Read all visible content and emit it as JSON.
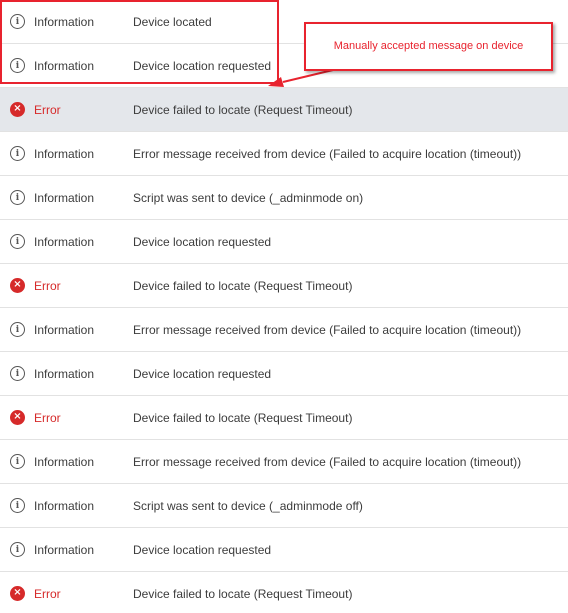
{
  "log_entries": [
    {
      "level": "info",
      "level_label": "Information",
      "message": "Device located"
    },
    {
      "level": "info",
      "level_label": "Information",
      "message": "Device location requested"
    },
    {
      "level": "error",
      "level_label": "Error",
      "message": "Device failed to locate (Request Timeout)"
    },
    {
      "level": "info",
      "level_label": "Information",
      "message": "Error message received from device (Failed to acquire location (timeout))"
    },
    {
      "level": "info",
      "level_label": "Information",
      "message": "Script was sent to device (_adminmode on)"
    },
    {
      "level": "info",
      "level_label": "Information",
      "message": "Device location requested"
    },
    {
      "level": "error",
      "level_label": "Error",
      "message": "Device failed to locate (Request Timeout)"
    },
    {
      "level": "info",
      "level_label": "Information",
      "message": "Error message received from device (Failed to acquire location (timeout))"
    },
    {
      "level": "info",
      "level_label": "Information",
      "message": "Device location requested"
    },
    {
      "level": "error",
      "level_label": "Error",
      "message": "Device failed to locate (Request Timeout)"
    },
    {
      "level": "info",
      "level_label": "Information",
      "message": "Error message received from device (Failed to acquire location (timeout))"
    },
    {
      "level": "info",
      "level_label": "Information",
      "message": "Script was sent to device (_adminmode off)"
    },
    {
      "level": "info",
      "level_label": "Information",
      "message": "Device location requested"
    },
    {
      "level": "error",
      "level_label": "Error",
      "message": "Device failed to locate (Request Timeout)"
    }
  ],
  "highlighted_row": 2,
  "annotation": {
    "text": "Manually accepted message on device",
    "color": "#e8232e"
  },
  "colors": {
    "error": "#d62a2a",
    "row_highlight": "#e4e7eb",
    "separator": "#e2e2e2"
  },
  "icons": {
    "info": "info-circle-icon",
    "error": "error-circle-x-icon"
  }
}
